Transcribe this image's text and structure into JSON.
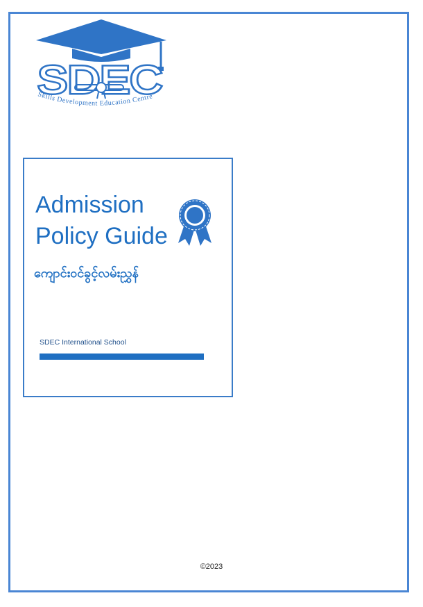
{
  "logo": {
    "wordmark": "SDEC",
    "tagline": "Skills Development Education Centre"
  },
  "cover": {
    "title_line1": "Admission",
    "title_line2": "Policy Guide",
    "title_myanmar": "ကျောင်းဝင်ခွင့်လမ်းညွှန်",
    "school_name": "SDEC International School"
  },
  "footer": {
    "copyright": "©2023"
  },
  "icons": {
    "award": "ribbon-award-icon",
    "logo_cap": "graduation-cap-icon"
  },
  "colors": {
    "primary": "#1f6fc2",
    "border": "#4a86d4"
  }
}
